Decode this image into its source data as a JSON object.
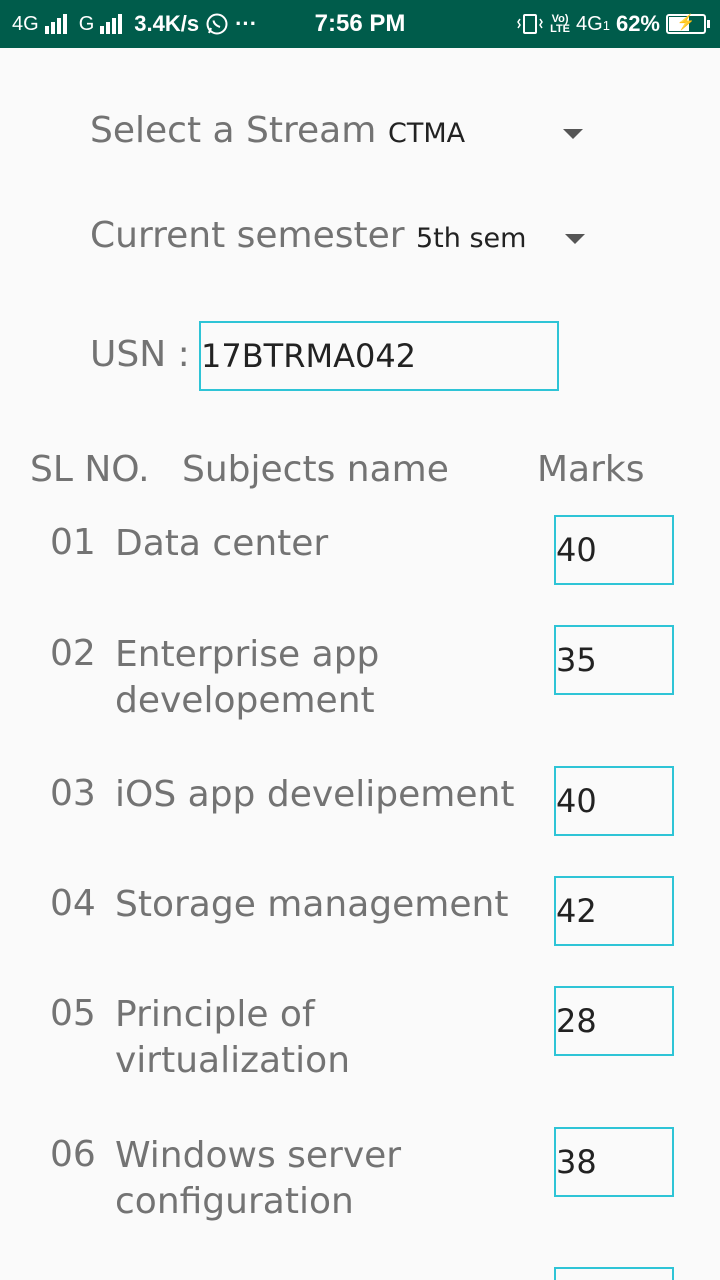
{
  "status_bar": {
    "network1": "4G",
    "network2": "G",
    "speed": "3.4K/s",
    "more": "···",
    "time": "7:56 PM",
    "volte_top": "Vo)",
    "volte_bottom": "LTE",
    "network3": "4G",
    "sim_index": "1",
    "battery": "62%",
    "battery_level": 0.62
  },
  "form": {
    "stream_label": "Select a Stream",
    "stream_value": "CTMA",
    "semester_label": "Current semester",
    "semester_value": "5th sem",
    "usn_label": "USN :",
    "usn_value": "17BTRMA042"
  },
  "table": {
    "headers": {
      "sl": "SL NO.",
      "subject": "Subjects name",
      "marks": "Marks"
    },
    "rows": [
      {
        "sl": "01",
        "subject": "Data center",
        "marks": "40"
      },
      {
        "sl": "02",
        "subject": "Enterprise app developement",
        "marks": "35"
      },
      {
        "sl": "03",
        "subject": "iOS app develipement",
        "marks": "40"
      },
      {
        "sl": "04",
        "subject": "Storage management",
        "marks": "42"
      },
      {
        "sl": "05",
        "subject": "Principle of virtualization",
        "marks": "28"
      },
      {
        "sl": "06",
        "subject": "Windows server configuration",
        "marks": "38"
      },
      {
        "sl": "",
        "subject": "",
        "marks": ""
      }
    ]
  },
  "colors": {
    "status_bar": "#005c4b",
    "input_border": "#2ec4d6",
    "label_text": "#737373",
    "background": "#fafafa"
  }
}
